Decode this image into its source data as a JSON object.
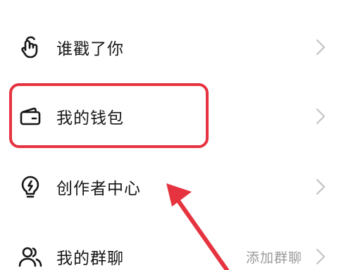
{
  "menu": {
    "items": [
      {
        "icon": "tap-finger-icon",
        "label": "谁戳了你",
        "extra": ""
      },
      {
        "icon": "wallet-icon",
        "label": "我的钱包",
        "extra": ""
      },
      {
        "icon": "lightbulb-icon",
        "label": "创作者中心",
        "extra": ""
      },
      {
        "icon": "group-users-icon",
        "label": "我的群聊",
        "extra": "添加群聊"
      }
    ]
  },
  "annotation": {
    "highlight_color": "#e5333f",
    "arrow_color": "#e5333f"
  }
}
